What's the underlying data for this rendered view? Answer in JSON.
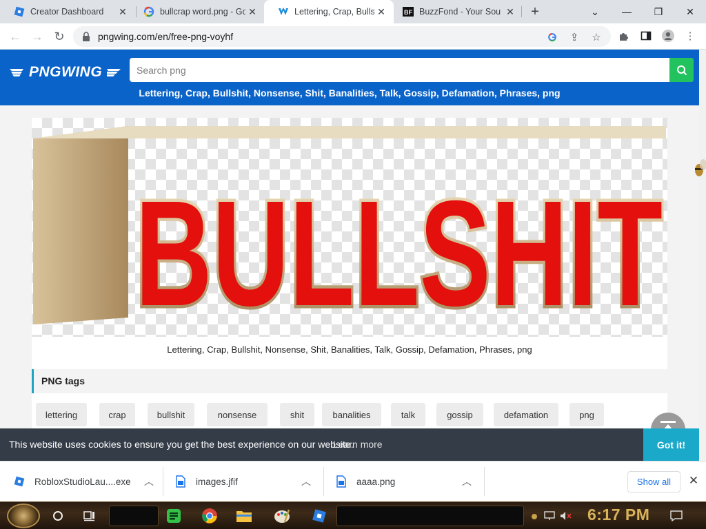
{
  "browser": {
    "tabs": [
      {
        "title": "Creator Dashboard",
        "icon": "roblox-studio-icon",
        "active": false
      },
      {
        "title": "bullcrap word.png - Go",
        "icon": "google-icon",
        "active": false
      },
      {
        "title": "Lettering, Crap, Bullsh",
        "icon": "pngwing-icon",
        "active": true
      },
      {
        "title": "BuzzFond - Your Sou",
        "icon": "buzzfond-icon",
        "active": false
      }
    ],
    "url": "pngwing.com/en/free-png-voyhf"
  },
  "site": {
    "logo_text": "PNGWING",
    "search_placeholder": "Search png",
    "header_title": "Lettering, Crap, Bullshit, Nonsense, Shit, Banalities, Talk, Gossip, Defamation, Phrases, png",
    "image_word": "BULLSHIT",
    "image_caption": "Lettering, Crap, Bullshit, Nonsense, Shit, Banalities, Talk, Gossip, Defamation, Phrases, png",
    "tags_heading": "PNG tags",
    "tags": [
      "lettering",
      "crap",
      "bullshit",
      "nonsense",
      "shit",
      "banalities",
      "talk",
      "gossip",
      "defamation",
      "png"
    ]
  },
  "cookie": {
    "message": "This website uses cookies to ensure you get the best experience on our website.",
    "learn_more": "Learn more",
    "accept": "Got it!"
  },
  "downloads": {
    "items": [
      {
        "name": "RobloxStudioLau....exe",
        "icon": "roblox-studio-icon"
      },
      {
        "name": "images.jfif",
        "icon": "image-file-icon"
      },
      {
        "name": "aaaa.png",
        "icon": "image-file-icon"
      }
    ],
    "show_all": "Show all"
  },
  "taskbar": {
    "time": "6:17 PM"
  },
  "colors": {
    "header_blue": "#0a63c9",
    "search_green": "#22c35e",
    "cookie_bg": "#343c48",
    "cookie_button": "#1aa9c9",
    "letter_red": "#e3100d",
    "letter_gold": "#d8c29a"
  }
}
